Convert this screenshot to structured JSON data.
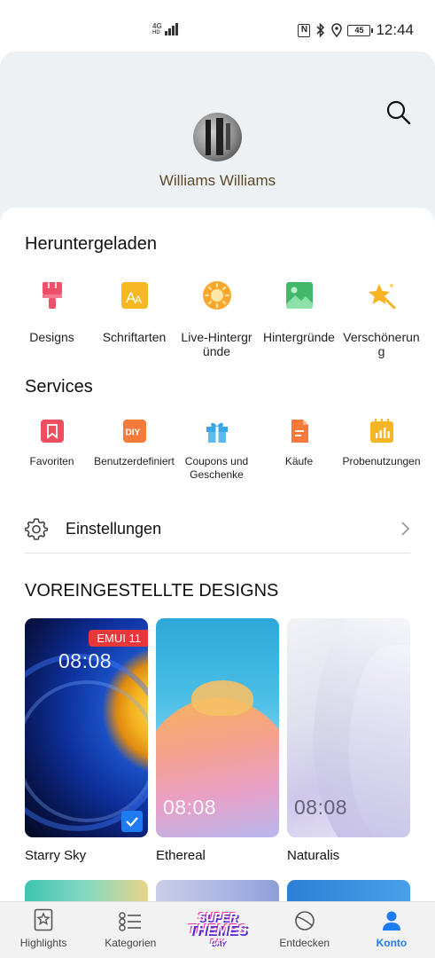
{
  "status_bar": {
    "network": "4G",
    "network_sub": "HD",
    "battery": "45",
    "time": "12:44"
  },
  "profile": {
    "name": "Williams Williams"
  },
  "downloaded": {
    "title": "Heruntergeladen",
    "items": [
      {
        "line1": "Designs",
        "line2": "",
        "icon": "designs-brush-icon",
        "color": "#ee4f6b"
      },
      {
        "line1": "Schriftarten",
        "line2": "",
        "icon": "fonts-icon",
        "color": "#f5b823"
      },
      {
        "line1": "Live-Hintergr",
        "line2": "ünde",
        "icon": "live-wallpaper-icon",
        "color": "#f8a72b"
      },
      {
        "line1": "Hintergründe",
        "line2": "",
        "icon": "wallpaper-image-icon",
        "color": "#43b86a"
      },
      {
        "line1": "Verschönerun",
        "line2": "g",
        "icon": "beautify-star-icon",
        "color": "#f8b427"
      }
    ]
  },
  "services": {
    "title": "Services",
    "items": [
      {
        "line1": "Favoriten",
        "line2": "",
        "icon": "favorites-bookmark-icon",
        "color": "#ee4f5e"
      },
      {
        "line1": "Benutzerdefiniert",
        "line2": "",
        "icon": "diy-icon",
        "color": "#f47b3a"
      },
      {
        "line1": "Coupons und",
        "line2": "Geschenke",
        "icon": "gift-icon",
        "color": "#3aa6e8"
      },
      {
        "line1": "Käufe",
        "line2": "",
        "icon": "purchases-document-icon",
        "color": "#f6783a"
      },
      {
        "line1": "Probenutzungen",
        "line2": "",
        "icon": "trials-calendar-icon",
        "color": "#f8b427"
      }
    ]
  },
  "settings": {
    "label": "Einstellungen"
  },
  "preset": {
    "title": "VOREINGESTELLTE DESIGNS",
    "themes": [
      {
        "name": "Starry Sky",
        "time": "08:08",
        "badge": "EMUI 11",
        "selected": true
      },
      {
        "name": "Ethereal",
        "time": "08:08",
        "badge": "",
        "selected": false
      },
      {
        "name": "Naturalis",
        "time": "08:08",
        "badge": "",
        "selected": false
      }
    ]
  },
  "bottom_nav": {
    "items": [
      {
        "label": "Highlights",
        "active": false
      },
      {
        "label": "Kategorien",
        "active": false
      },
      {
        "label": "",
        "promo_line1": "SUPER",
        "promo_line2": "THEMES",
        "promo_line3": "DAY"
      },
      {
        "label": "Entdecken",
        "active": false
      },
      {
        "label": "Konto",
        "active": true
      }
    ]
  },
  "colors": {
    "accent": "#1e7bf2",
    "header_bg": "#eef1f3",
    "badge_red": "#e8373a"
  }
}
